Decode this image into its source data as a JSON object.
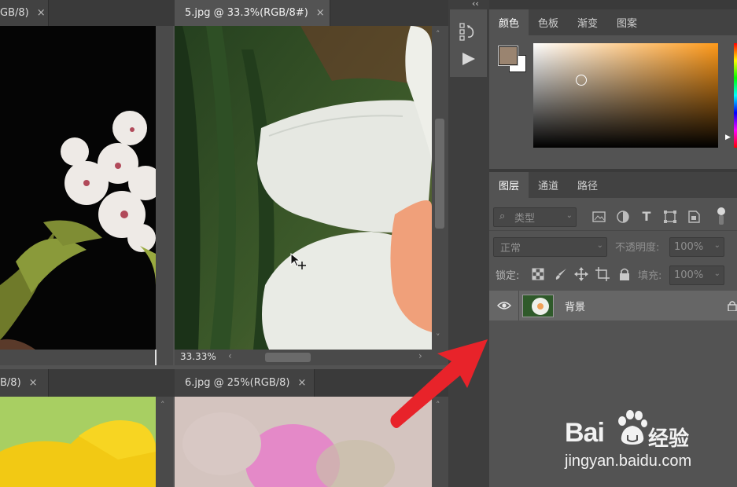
{
  "documents": {
    "tab_left_top": {
      "title": "GB/8)",
      "close": "×"
    },
    "tab_active": {
      "title": "5.jpg @ 33.3%(RGB/8#)",
      "close": "×"
    },
    "tab_left_bottom": {
      "title": "B/8)",
      "close": "×"
    },
    "tab_right_bottom": {
      "title": "6.jpg @ 25%(RGB/8)",
      "close": "×"
    },
    "zoom_readout": "33.33%"
  },
  "color_panel": {
    "tabs": [
      "颜色",
      "色板",
      "渐变",
      "图案"
    ],
    "active_tab": "颜色",
    "foreground_color": "#9a8470",
    "background_color": "#ffffff",
    "picker_hue": "#ff9a1a"
  },
  "layers_panel": {
    "tabs": [
      "图层",
      "通道",
      "路径"
    ],
    "active_tab": "图层",
    "filter_kind": "类型",
    "blend_mode": "正常",
    "opacity_label": "不透明度:",
    "opacity_value": "100%",
    "lock_label": "锁定:",
    "fill_label": "填充:",
    "fill_value": "100%",
    "layers": [
      {
        "name": "背景",
        "visible": true,
        "locked": true
      }
    ]
  },
  "watermark": {
    "brand": "Bai",
    "brand_cn": "经验",
    "url": "jingyan.baidu.com"
  },
  "colors": {
    "arrow": "#e8232a",
    "panel_bg": "#535353",
    "tab_bar": "#3a3a3a"
  }
}
